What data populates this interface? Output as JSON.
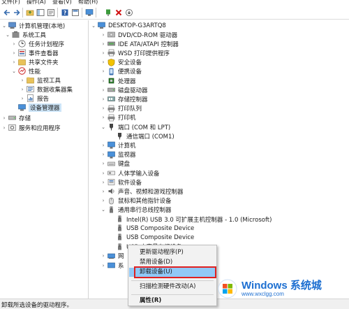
{
  "menubar": {
    "file": "文件(F)",
    "action": "操作(A)",
    "view": "查看(V)",
    "help": "帮助(H)"
  },
  "left_tree": {
    "root": "计算机管理(本地)",
    "system_tools": "系统工具",
    "task_scheduler": "任务计划程序",
    "event_viewer": "事件查看器",
    "shared_folders": "共享文件夹",
    "performance": "性能",
    "monitoring_tools": "监视工具",
    "data_collector_sets": "数据收集器集",
    "reports": "报告",
    "device_manager": "设备管理器",
    "storage": "存储",
    "services_apps": "服务和应用程序"
  },
  "device_tree": {
    "computer": "DESKTOP-G3ARTQ8",
    "categories": [
      "DVD/CD-ROM 驱动器",
      "IDE ATA/ATAPI 控制器",
      "WSD 打印提供程序",
      "安全设备",
      "便携设备",
      "处理器",
      "磁盘驱动器",
      "存储控制器",
      "打印队列",
      "打印机",
      "端口 (COM 和 LPT)",
      "通信端口 (COM1)",
      "计算机",
      "监视器",
      "键盘",
      "人体学输入设备",
      "软件设备",
      "声音、视频和游戏控制器",
      "鼠标和其他指针设备",
      "通用串行总线控制器",
      "Intel(R) USB 3.0 可扩展主机控制器 - 1.0 (Microsoft)",
      "USB Composite Device",
      "USB Composite Device",
      "USB 大容量存储设备",
      "网",
      "系"
    ]
  },
  "context_menu": {
    "update_driver": "更新驱动程序(P)",
    "disable_device": "禁用设备(D)",
    "uninstall_device": "卸载设备(U)",
    "scan_hardware": "扫描检测硬件改动(A)",
    "properties": "属性(R)"
  },
  "status_bar": {
    "text": "卸载所选设备的驱动程序。"
  },
  "watermark": {
    "title": "Windows 系统城",
    "url": "www.wxclgg.com"
  },
  "colors": {
    "selection": "#cce4f7",
    "menu_highlight": "#91c9f7",
    "red_box": "#e02020",
    "watermark": "#1d6fd1"
  }
}
